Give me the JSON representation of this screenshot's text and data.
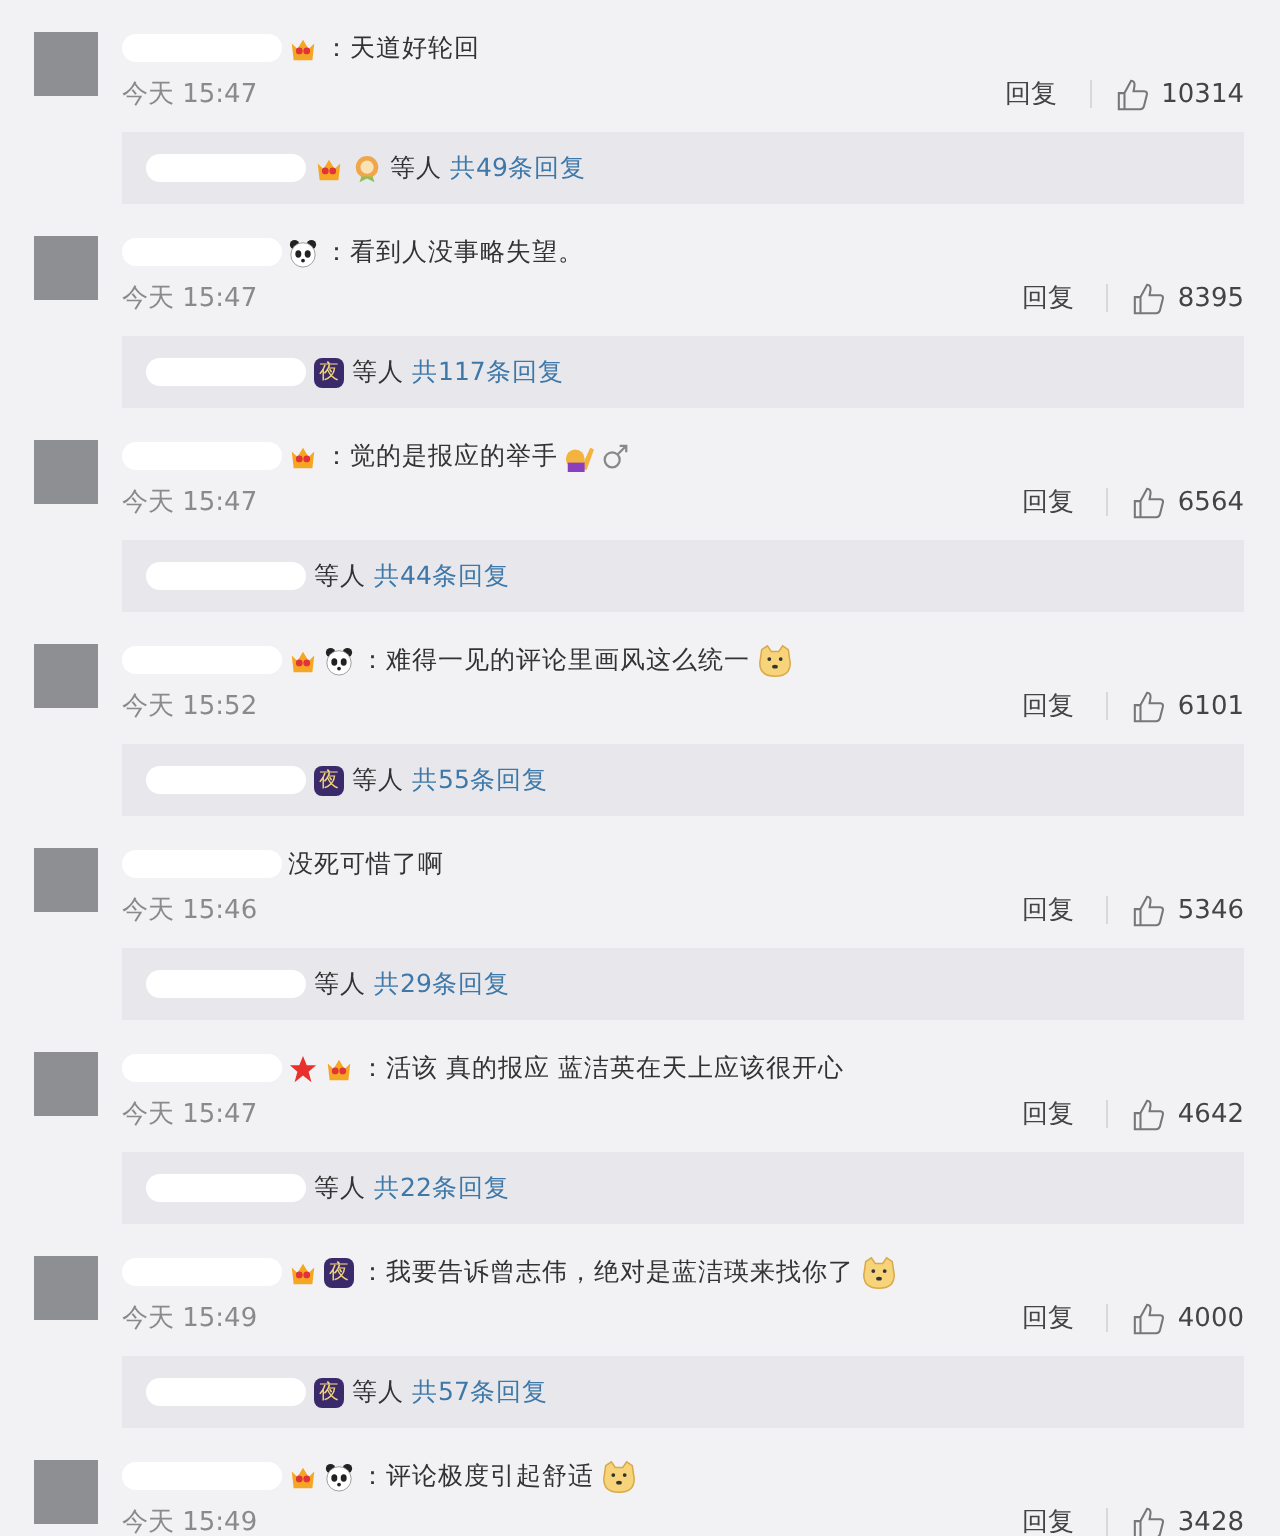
{
  "comments": [
    {
      "badges": [
        {
          "kind": "crown"
        }
      ],
      "text": "：天道好轮回",
      "time": "今天 15:47",
      "reply_label": "回复",
      "likes": "10314",
      "replies": {
        "badges": [
          {
            "kind": "crown"
          },
          {
            "kind": "medal"
          }
        ],
        "others": "等人",
        "total": "共49条回复"
      }
    },
    {
      "badges": [
        {
          "kind": "panda"
        }
      ],
      "text": "：看到人没事略失望。",
      "time": "今天 15:47",
      "reply_label": "回复",
      "likes": "8395",
      "replies": {
        "badges": [
          {
            "kind": "night",
            "label": "夜"
          }
        ],
        "others": "等人",
        "total": "共117条回复"
      }
    },
    {
      "badges": [
        {
          "kind": "crown"
        }
      ],
      "text": "：觉的是报应的举手",
      "trailing": [
        {
          "kind": "raise-hand"
        },
        {
          "kind": "male"
        }
      ],
      "time": "今天 15:47",
      "reply_label": "回复",
      "likes": "6564",
      "replies": {
        "others": "等人",
        "total": "共44条回复"
      }
    },
    {
      "badges": [
        {
          "kind": "crown"
        },
        {
          "kind": "panda"
        }
      ],
      "text": "：难得一见的评论里画风这么统一",
      "trailing": [
        {
          "kind": "doge"
        }
      ],
      "time": "今天 15:52",
      "reply_label": "回复",
      "likes": "6101",
      "replies": {
        "badges": [
          {
            "kind": "night",
            "label": "夜"
          }
        ],
        "others": "等人",
        "total": "共55条回复"
      }
    },
    {
      "text": "没死可惜了啊",
      "time": "今天 15:46",
      "reply_label": "回复",
      "likes": "5346",
      "replies": {
        "others": "等人",
        "total": "共29条回复"
      }
    },
    {
      "badges": [
        {
          "kind": "star"
        },
        {
          "kind": "crown"
        }
      ],
      "text": "：活该 真的报应 蓝洁英在天上应该很开心",
      "time": "今天 15:47",
      "reply_label": "回复",
      "likes": "4642",
      "replies": {
        "others": "等人",
        "total": "共22条回复"
      }
    },
    {
      "badges": [
        {
          "kind": "crown"
        },
        {
          "kind": "night",
          "label": "夜"
        }
      ],
      "text": "：我要告诉曾志伟，绝对是蓝洁瑛来找你了",
      "trailing": [
        {
          "kind": "doge"
        }
      ],
      "time": "今天 15:49",
      "reply_label": "回复",
      "likes": "4000",
      "replies": {
        "badges": [
          {
            "kind": "night",
            "label": "夜"
          }
        ],
        "others": "等人",
        "total": "共57条回复"
      }
    },
    {
      "badges": [
        {
          "kind": "crown"
        },
        {
          "kind": "panda"
        }
      ],
      "text": "：评论极度引起舒适",
      "trailing": [
        {
          "kind": "doge"
        }
      ],
      "time": "今天 15:49",
      "reply_label": "回复",
      "likes": "3428"
    }
  ]
}
